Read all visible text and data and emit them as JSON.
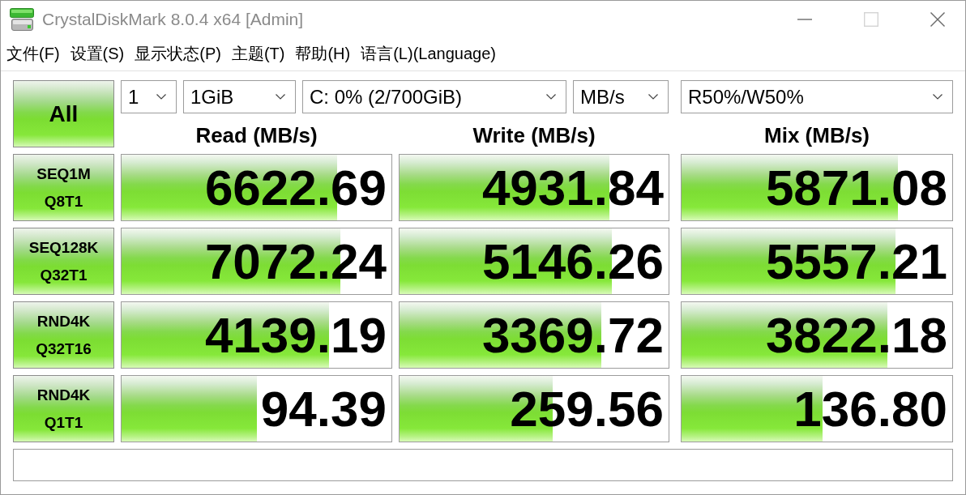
{
  "window": {
    "title": "CrystalDiskMark 8.0.4 x64 [Admin]",
    "controls": [
      {
        "kind": "minimize",
        "disabled": false
      },
      {
        "kind": "maximize",
        "disabled": true
      },
      {
        "kind": "close",
        "disabled": false
      }
    ]
  },
  "menu": [
    "文件(F)",
    "设置(S)",
    "显示状态(P)",
    "主题(T)",
    "帮助(H)",
    "语言(L)(Language)"
  ],
  "all_button": "All",
  "selectors": [
    {
      "value": "1"
    },
    {
      "value": "1GiB"
    },
    {
      "value": "C: 0% (2/700GiB)"
    },
    {
      "value": "MB/s"
    }
  ],
  "mix_selector": {
    "value": "R50%/W50%"
  },
  "columns": [
    "Read (MB/s)",
    "Write (MB/s)",
    "Mix (MB/s)"
  ],
  "tests": [
    {
      "name": "SEQ1M",
      "params": "Q8T1",
      "results": [
        {
          "value": "6622.69",
          "level": 0.8
        },
        {
          "value": "4931.84",
          "level": 0.78
        },
        {
          "value": "5871.08",
          "level": 0.8
        }
      ]
    },
    {
      "name": "SEQ128K",
      "params": "Q32T1",
      "results": [
        {
          "value": "7072.24",
          "level": 0.81
        },
        {
          "value": "5146.26",
          "level": 0.79
        },
        {
          "value": "5557.21",
          "level": 0.79
        }
      ]
    },
    {
      "name": "RND4K",
      "params": "Q32T16",
      "results": [
        {
          "value": "4139.19",
          "level": 0.77
        },
        {
          "value": "3369.72",
          "level": 0.75
        },
        {
          "value": "3822.18",
          "level": 0.76
        }
      ]
    },
    {
      "name": "RND4K",
      "params": "Q1T1",
      "results": [
        {
          "value": "94.39",
          "level": 0.5
        },
        {
          "value": "259.56",
          "level": 0.57
        },
        {
          "value": "136.80",
          "level": 0.52
        }
      ]
    }
  ]
}
